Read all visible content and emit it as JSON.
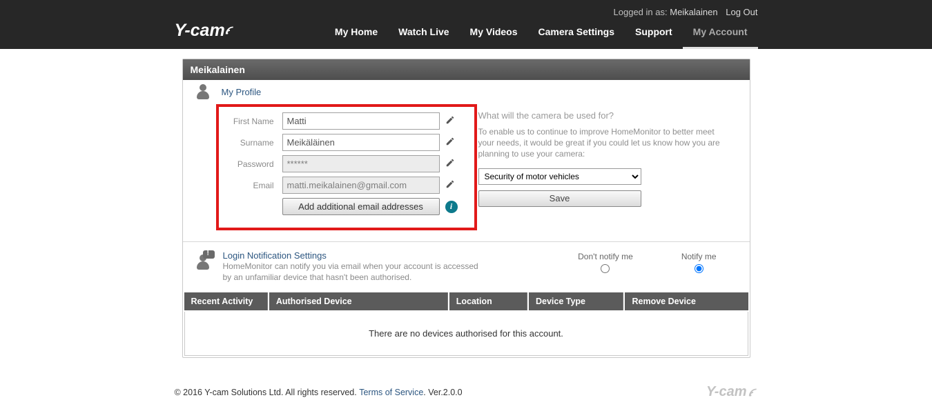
{
  "logo": "Y-cam",
  "auth": {
    "logged_in_as_label": "Logged in as:",
    "username": "Meikalainen",
    "logout": "Log Out"
  },
  "nav": {
    "my_home": "My Home",
    "watch_live": "Watch Live",
    "my_videos": "My Videos",
    "camera_settings": "Camera Settings",
    "support": "Support",
    "my_account": "My Account"
  },
  "panel": {
    "title": "Meikalainen"
  },
  "profile": {
    "section_title": "My Profile",
    "first_name_label": "First Name",
    "first_name_value": "Matti",
    "surname_label": "Surname",
    "surname_value": "Meikäläinen",
    "password_label": "Password",
    "password_value": "******",
    "email_label": "Email",
    "email_value": "matti.meikalainen@gmail.com",
    "add_emails_label": "Add additional email addresses"
  },
  "usage": {
    "question": "What will the camera be used for?",
    "description": "To enable us to continue to improve HomeMonitor to better meet your needs, it would be great if you could let us know how you are planning to use your camera:",
    "selected": "Security of motor vehicles",
    "save_label": "Save"
  },
  "login_notif": {
    "title": "Login Notification Settings",
    "description": "HomeMonitor can notify you via email when your account is accessed by an unfamiliar device that hasn't been authorised.",
    "dont_notify_label": "Don't notify me",
    "notify_label": "Notify me"
  },
  "table": {
    "cols": {
      "recent_activity": "Recent Activity",
      "authorised_device": "Authorised Device",
      "location": "Location",
      "device_type": "Device Type",
      "remove_device": "Remove Device"
    },
    "empty": "There are no devices authorised for this account."
  },
  "footer": {
    "copyright": "© 2016 Y-cam Solutions Ltd. All rights reserved.",
    "tos": "Terms of Service",
    "version_label": ". Ver. ",
    "version": "2.0.0",
    "foot_logo": "Y-cam"
  }
}
